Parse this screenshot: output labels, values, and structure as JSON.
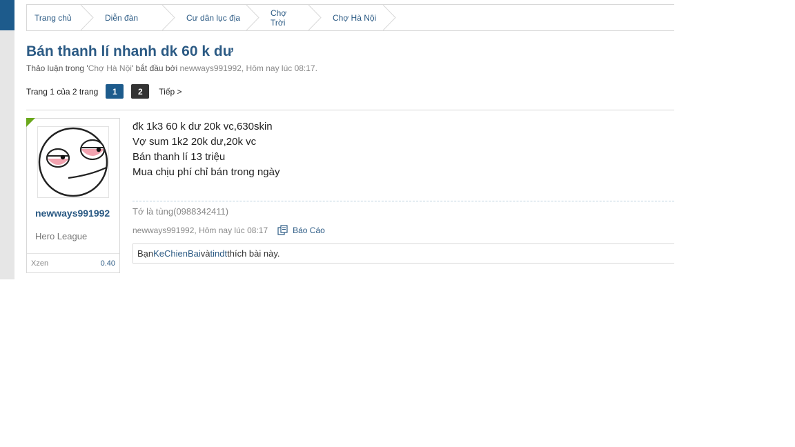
{
  "breadcrumb": [
    "Trang chủ",
    "Diễn đàn",
    "Cư dân lục địa",
    "Chợ Trời",
    "Chợ Hà Nội"
  ],
  "thread": {
    "title": "Bán thanh lí nhanh dk 60 k dư",
    "meta_prefix": "Thảo luận trong '",
    "meta_forum": "Chợ Hà Nội",
    "meta_mid": "' bắt đầu bởi ",
    "meta_author": "newways991992",
    "meta_sep": ", ",
    "meta_time": "Hôm nay lúc 08:17",
    "meta_end": "."
  },
  "pager": {
    "label": "Trang 1 của 2 trang",
    "pages": [
      "1",
      "2"
    ],
    "next": "Tiếp >"
  },
  "author": {
    "username": "newways991992",
    "rank": "Hero League",
    "stat_label": "Xzen",
    "stat_value": "0.40"
  },
  "post": {
    "lines": [
      "đk 1k3 60 k dư 20k vc,630skin",
      "Vợ sum 1k2 20k dư,20k vc",
      "Bán thanh lí 13 triệu",
      "Mua chịu phí chỉ bán trong ngày"
    ],
    "signature": "Tớ là tùng(0988342411)",
    "meta": "newways991992, Hôm nay lúc 08:17",
    "report": "Báo Cáo"
  },
  "likes": {
    "prefix": "Bạn ",
    "user1": "KeChienBai",
    "mid": " và ",
    "user2": "tindt",
    "suffix": " thích bài này."
  },
  "colors": {
    "accent": "#1d5b8c",
    "link": "#2b5a84",
    "corner": "#6aa81c"
  },
  "icons": [
    "breadcrumb-chevron-icon",
    "report-icon",
    "avatar-face-icon"
  ]
}
